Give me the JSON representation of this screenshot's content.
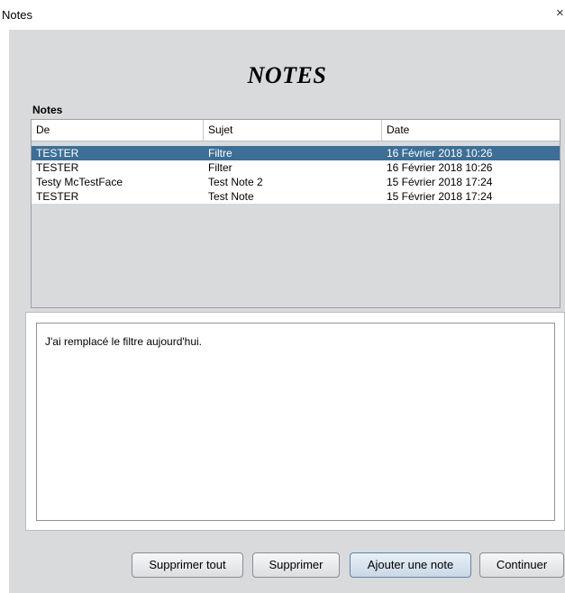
{
  "window": {
    "title": "Notes",
    "close_glyph": "×"
  },
  "heading": "NOTES",
  "notes_section": {
    "label": "Notes",
    "columns": [
      "De",
      "Sujet",
      "Date"
    ],
    "rows": [
      {
        "de": "TESTER",
        "sujet": "Filtre",
        "date": "16 Février 2018 10:26",
        "selected": true
      },
      {
        "de": "TESTER",
        "sujet": "Filter",
        "date": "16 Février 2018 10:26",
        "selected": false
      },
      {
        "de": "Testy McTestFace",
        "sujet": "Test Note 2",
        "date": "15 Février 2018 17:24",
        "selected": false
      },
      {
        "de": "TESTER",
        "sujet": "Test Note",
        "date": "15 Février 2018 17:24",
        "selected": false
      }
    ]
  },
  "note_body": "J'ai remplacé le filtre aujourd'hui.",
  "buttons": {
    "delete_all": "Supprimer tout",
    "delete": "Supprimer",
    "add_note": "Ajouter une note",
    "continue": "Continuer"
  },
  "colors": {
    "selection": "#3c6e96",
    "panel": "#d9dadc"
  }
}
